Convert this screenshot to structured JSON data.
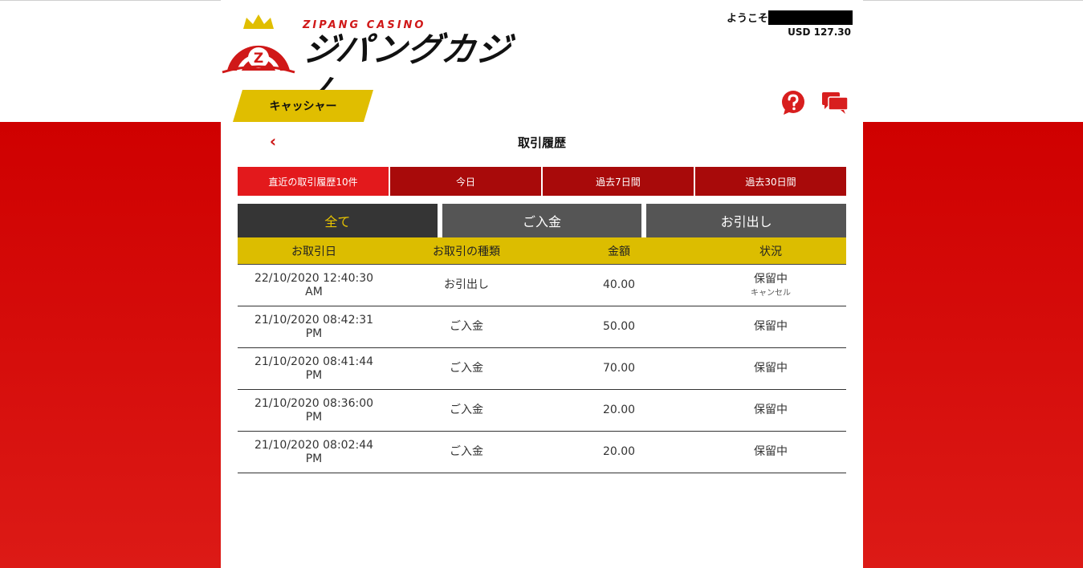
{
  "brand": {
    "sub": "ZIPANG CASINO",
    "main": "ジパングカジノ",
    "emblem_letter": "Z",
    "red": "#d01818",
    "gold": "#e0be00"
  },
  "account": {
    "welcome": "ようこそ",
    "balance": "USD 127.30"
  },
  "nav": {
    "cashier": "キャッシャー",
    "help_icon": "question-circle-icon",
    "chat_icon": "chat-bubbles-icon"
  },
  "page": {
    "back": "‹",
    "title": "取引履歴"
  },
  "period_tabs": [
    "直近の取引履歴10件",
    "今日",
    "過去7日間",
    "過去30日間"
  ],
  "type_tabs": [
    "全て",
    "ご入金",
    "お引出し"
  ],
  "table": {
    "headers": [
      "お取引日",
      "お取引の種類",
      "金額",
      "状況"
    ],
    "rows": [
      {
        "date": "22/10/2020 12:40:30",
        "ampm": "AM",
        "type": "お引出し",
        "amount": "40.00",
        "status": "保留中",
        "action": "キャンセル"
      },
      {
        "date": "21/10/2020 08:42:31",
        "ampm": "PM",
        "type": "ご入金",
        "amount": "50.00",
        "status": "保留中"
      },
      {
        "date": "21/10/2020 08:41:44",
        "ampm": "PM",
        "type": "ご入金",
        "amount": "70.00",
        "status": "保留中"
      },
      {
        "date": "21/10/2020 08:36:00",
        "ampm": "PM",
        "type": "ご入金",
        "amount": "20.00",
        "status": "保留中"
      },
      {
        "date": "21/10/2020 08:02:44",
        "ampm": "PM",
        "type": "ご入金",
        "amount": "20.00",
        "status": "保留中"
      }
    ]
  }
}
